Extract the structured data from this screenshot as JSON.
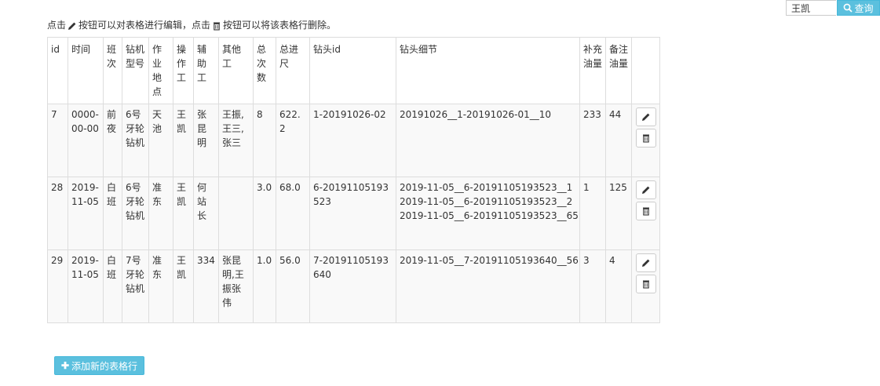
{
  "search": {
    "value": "王凯",
    "button_label": "查询"
  },
  "hint": {
    "part1": "点击",
    "part2": "按钮可以对表格进行编辑，点击",
    "part3": "按钮可以将该表格行删除。"
  },
  "table": {
    "headers": [
      "id",
      "时间",
      "班次",
      "钻机型号",
      "作业地点",
      "操作工",
      "辅助工",
      "其他工",
      "总次数",
      "总进尺",
      "钻头id",
      "钻头细节",
      "补充油量",
      "备注油量"
    ],
    "rows": [
      {
        "id": "7",
        "time": "0000-00-00",
        "shift": "前夜",
        "model": "6号牙轮钻机",
        "location": "天池",
        "operator": "王凯",
        "assistant": "张昆明",
        "others": "王振,王三,张三",
        "total_count": "8",
        "total_footage": "622.2",
        "bit_id": "1-20191026-02",
        "bit_details": [
          "20191026__1-20191026-01__10"
        ],
        "oil_added": "233",
        "oil_note": "44"
      },
      {
        "id": "28",
        "time": "2019-11-05",
        "shift": "白班",
        "model": "6号牙轮钻机",
        "location": "准东",
        "operator": "王凯",
        "assistant": "何站长",
        "others": "",
        "total_count": "3.0",
        "total_footage": "68.0",
        "bit_id": "6-20191105193523",
        "bit_details": [
          "2019-11-05__6-20191105193523__1",
          "2019-11-05__6-20191105193523__2",
          "2019-11-05__6-20191105193523__65"
        ],
        "oil_added": "1",
        "oil_note": "125"
      },
      {
        "id": "29",
        "time": "2019-11-05",
        "shift": "白班",
        "model": "7号牙轮钻机",
        "location": "准东",
        "operator": "王凯",
        "assistant": "334",
        "others": "张昆明,王振张伟",
        "total_count": "1.0",
        "total_footage": "56.0",
        "bit_id": "7-20191105193640",
        "bit_details": [
          "2019-11-05__7-20191105193640__56"
        ],
        "oil_added": "3",
        "oil_note": "4"
      }
    ]
  },
  "add_button_label": "添加新的表格行",
  "icons": {
    "search": "search-icon",
    "edit": "pencil-icon",
    "delete": "trash-icon",
    "add": "plus-icon"
  },
  "colors": {
    "accent": "#5bc0de",
    "border": "#dddddd",
    "row_bg": "#f9f9f9"
  }
}
